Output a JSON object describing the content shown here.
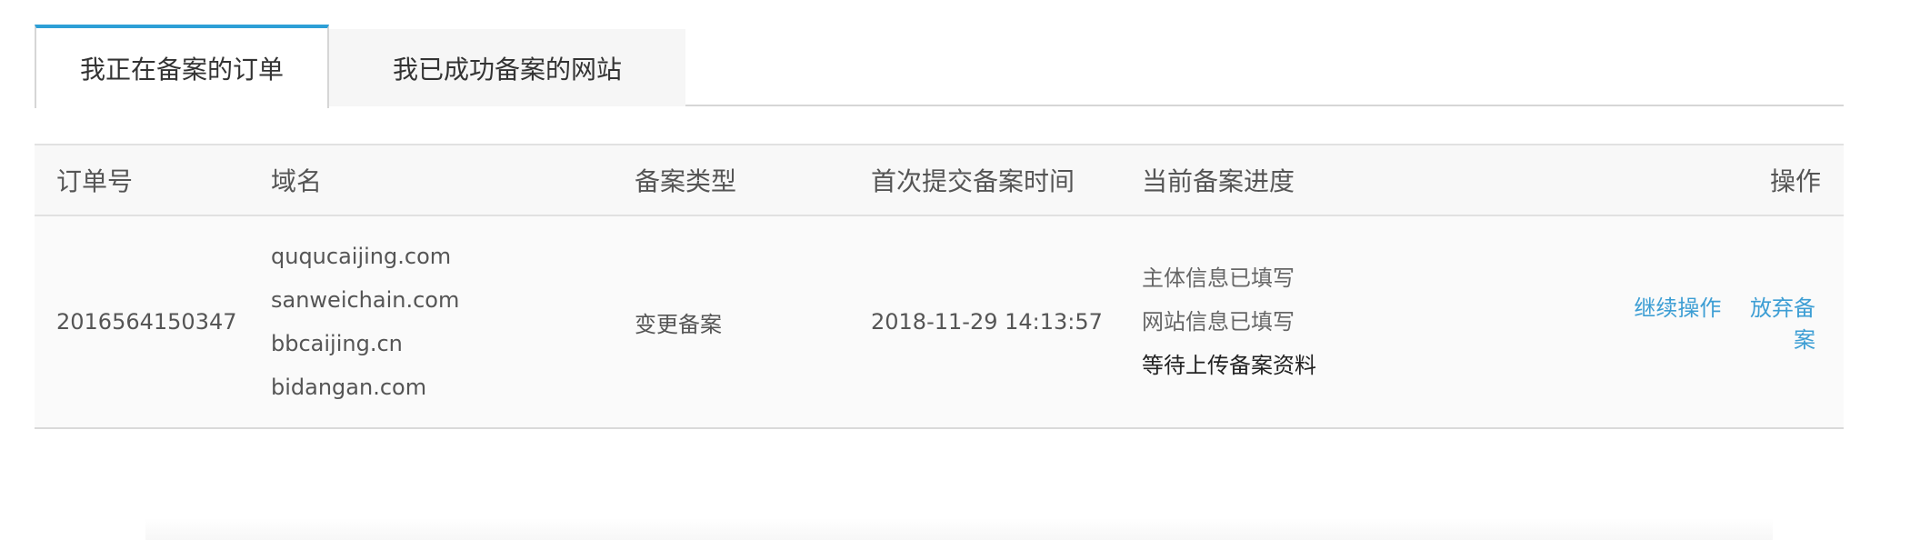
{
  "tabs": [
    {
      "label": "我正在备案的订单",
      "active": true
    },
    {
      "label": "我已成功备案的网站",
      "active": false
    }
  ],
  "table": {
    "headers": {
      "order_no": "订单号",
      "domain": "域名",
      "filing_type": "备案类型",
      "first_submit_time": "首次提交备案时间",
      "progress": "当前备案进度",
      "actions": "操作"
    },
    "rows": [
      {
        "order_no": "2016564150347",
        "domains": [
          "ququcaijing.com",
          "sanweichain.com",
          "bbcaijing.cn",
          "bidangan.com"
        ],
        "filing_type": "变更备案",
        "first_submit_time": "2018-11-29 14:13:57",
        "progress": [
          "主体信息已填写",
          "网站信息已填写",
          "等待上传备案资料"
        ],
        "actions": {
          "continue": "继续操作",
          "abandon": "放弃备案"
        }
      }
    ]
  },
  "colors": {
    "accent": "#2d9fd6",
    "link": "#3d9ed4",
    "header_bg": "#f8f8f8",
    "row_bg": "#fafafa"
  }
}
